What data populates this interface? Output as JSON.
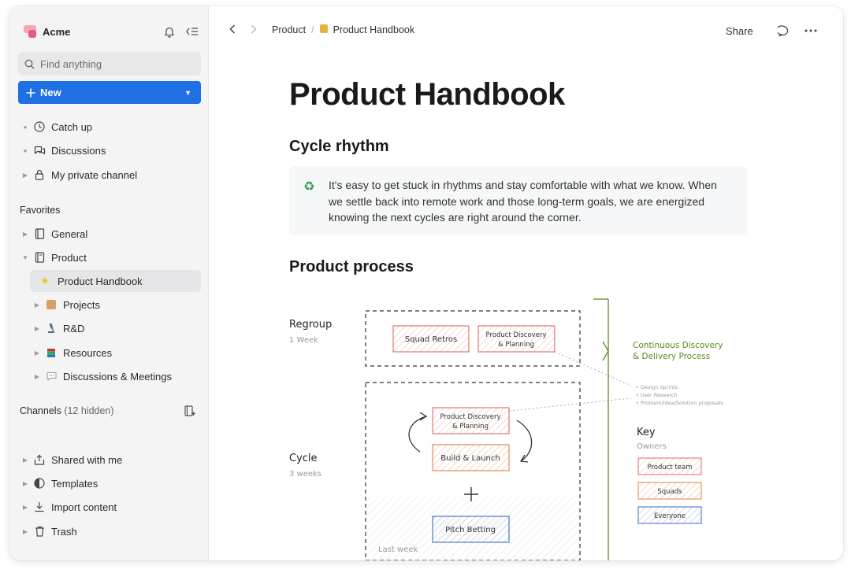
{
  "workspace": {
    "name": "Acme"
  },
  "search": {
    "placeholder": "Find anything"
  },
  "new_button": {
    "label": "New"
  },
  "primary_nav": [
    {
      "label": "Catch up",
      "icon": "clock-icon"
    },
    {
      "label": "Discussions",
      "icon": "chat-icon"
    },
    {
      "label": "My private channel",
      "icon": "lock-icon"
    }
  ],
  "favorites": {
    "title": "Favorites",
    "items": [
      {
        "label": "General",
        "icon": "book-icon"
      },
      {
        "label": "Product",
        "icon": "book-open-icon"
      },
      {
        "label": "Product Handbook",
        "icon": "star-icon"
      },
      {
        "label": "Projects",
        "icon": "folder-icon"
      },
      {
        "label": "R&D",
        "icon": "microscope-icon"
      },
      {
        "label": "Resources",
        "icon": "books-icon"
      },
      {
        "label": "Discussions & Meetings",
        "icon": "speech-bubble-icon"
      }
    ]
  },
  "channels": {
    "title": "Channels",
    "hidden_note": "(12 hidden)"
  },
  "bottom_nav": [
    {
      "label": "Shared with me",
      "icon": "share-icon"
    },
    {
      "label": "Templates",
      "icon": "templates-icon"
    },
    {
      "label": "Import content",
      "icon": "import-icon"
    },
    {
      "label": "Trash",
      "icon": "trash-icon"
    }
  ],
  "breadcrumb": {
    "parent": "Product",
    "separator": "/",
    "current": "Product Handbook"
  },
  "toolbar": {
    "share_label": "Share"
  },
  "document": {
    "title": "Product Handbook",
    "section1_heading": "Cycle rhythm",
    "callout_text": "It's easy to get stuck in rhythms and stay comfortable with what we know. When we settle back into remote work and those long-term goals, we are energized knowing the next cycles are right around the corner.",
    "section2_heading": "Product process"
  },
  "diagram": {
    "regroup": {
      "title": "Regroup",
      "duration": "1 Week"
    },
    "cycle": {
      "title": "Cycle",
      "duration": "3 weeks"
    },
    "boxes": {
      "squad_retros": "Squad Retros",
      "discovery_top_1": "Product Discovery",
      "discovery_top_2": "& Planning",
      "discovery_mid_1": "Product Discovery",
      "discovery_mid_2": "& Planning",
      "build_launch": "Build & Launch",
      "pitch_betting": "Pitch Betting",
      "last_week": "Last week"
    },
    "continuous_1": "Continuous Discovery",
    "continuous_2": "& Delivery Process",
    "notes": [
      "• Design Sprints",
      "• User Research",
      "• Problem/Idea/Solution proposals"
    ],
    "key": {
      "title": "Key",
      "subtitle": "Owners",
      "items": [
        "Product team",
        "Squads",
        "Everyone"
      ]
    }
  },
  "colors": {
    "accent": "#1f6fe5",
    "sidebar_bg": "#f4f4f5",
    "red_box": "#e07a6e",
    "orange_box": "#e58a55",
    "blue_box": "#4a78c8",
    "green_annotation": "#5a8a1f"
  }
}
